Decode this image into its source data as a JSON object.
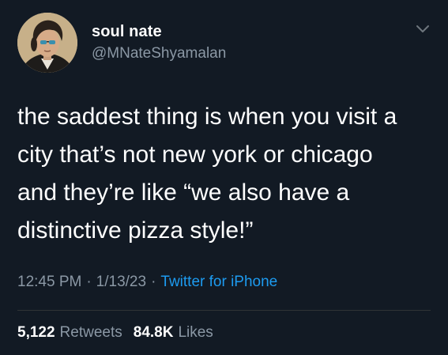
{
  "author": {
    "display_name": "soul nate",
    "handle": "@MNateShyamalan",
    "avatar_icon": "portrait-avatar-icon"
  },
  "menu": {
    "caret_icon": "chevron-down-icon"
  },
  "tweet": {
    "lines": [
      "the saddest thing is when you visit a",
      "city that’s not new york or chicago",
      "and they’re like “we also have a",
      "distinctive pizza style!”"
    ]
  },
  "meta": {
    "time": "12:45 PM",
    "separator": "·",
    "date": "1/13/23",
    "source": "Twitter for iPhone"
  },
  "stats": {
    "retweets_count": "5,122",
    "retweets_label": "Retweets",
    "likes_count": "84.8K",
    "likes_label": "Likes"
  },
  "colors": {
    "background": "#121a24",
    "text_primary": "#ffffff",
    "text_secondary": "#8b98a5",
    "link": "#1d9bf0"
  }
}
